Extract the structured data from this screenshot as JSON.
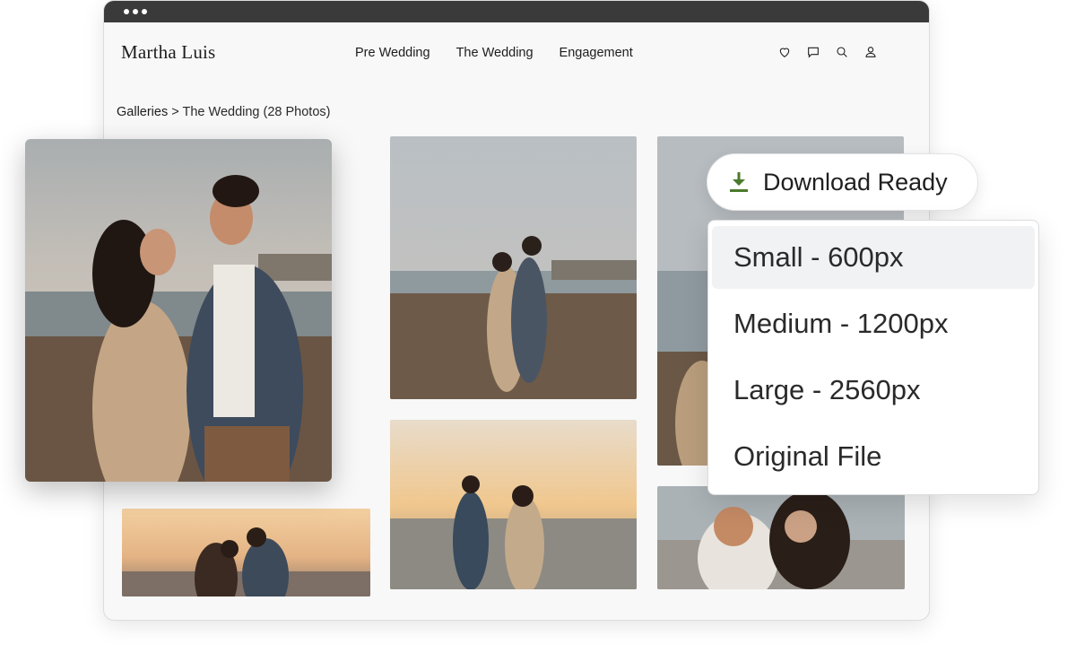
{
  "header": {
    "brand": "Martha Luis",
    "nav": [
      "Pre Wedding",
      "The Wedding",
      "Engagement"
    ],
    "icons": [
      "heart-icon",
      "chat-icon",
      "search-icon",
      "user-icon"
    ]
  },
  "breadcrumb": {
    "root": "Galleries",
    "separator": ">",
    "current": "The Wedding (28 Photos)"
  },
  "download": {
    "label": "Download Ready",
    "icon": "download-icon",
    "icon_color": "#4a7a2c"
  },
  "download_menu": {
    "options": [
      "Small - 600px",
      "Medium - 1200px",
      "Large - 2560px",
      "Original File"
    ],
    "highlighted": "Small - 600px"
  }
}
